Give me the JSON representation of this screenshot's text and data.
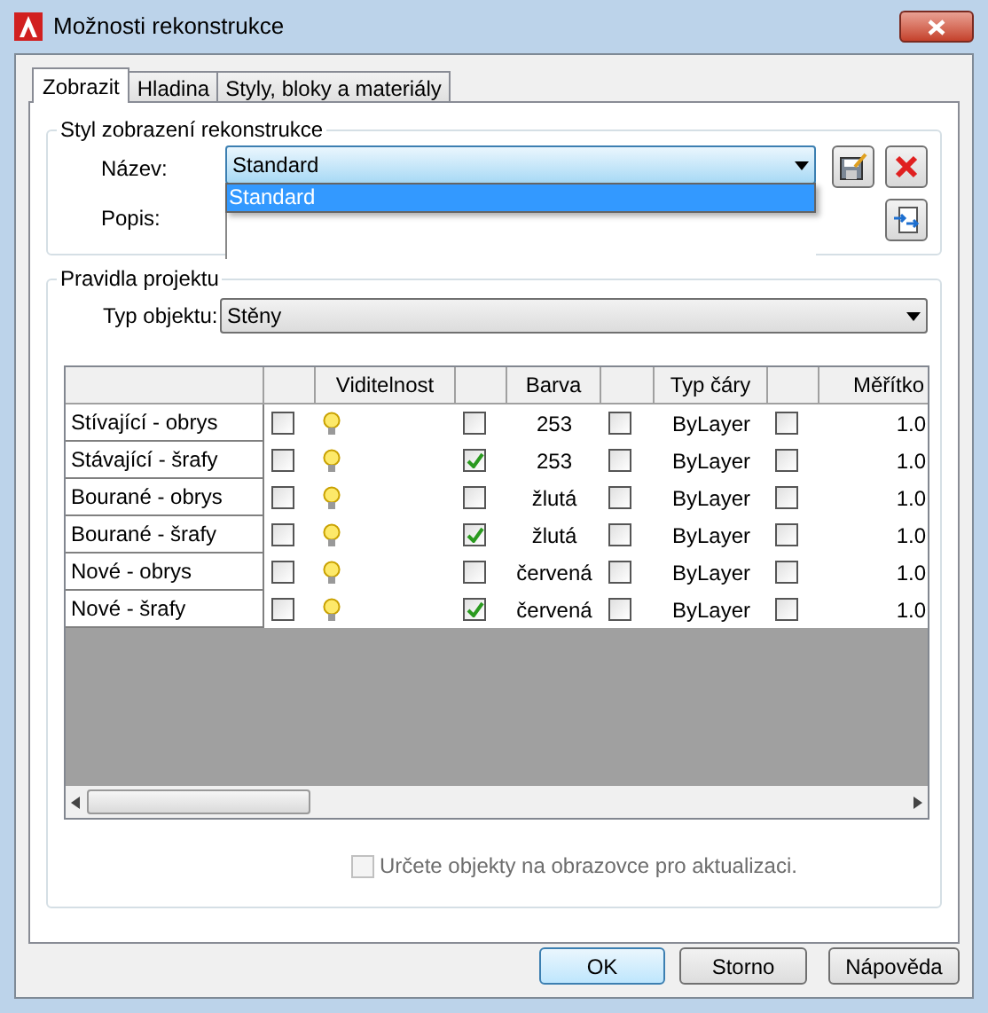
{
  "window": {
    "title": "Možnosti rekonstrukce"
  },
  "tabs": [
    {
      "label": "Zobrazit",
      "selected": true
    },
    {
      "label": "Hladina",
      "selected": false
    },
    {
      "label": "Styly, bloky a materiály",
      "selected": false
    }
  ],
  "style_group": {
    "title": "Styl zobrazení rekonstrukce",
    "name_label": "Název:",
    "name_value": "Standard",
    "dropdown_options": [
      {
        "label": "Standard",
        "selected": true
      }
    ],
    "description_label": "Popis:"
  },
  "rules_group": {
    "title": "Pravidla projektu",
    "object_type_label": "Typ objektu:",
    "object_type_value": "Stěny",
    "table": {
      "columns": [
        "Viditelnost",
        "Barva",
        "Typ čáry",
        "Měřítko"
      ],
      "rows": [
        {
          "name": "Stívající - obrys",
          "check_1": false,
          "visible": true,
          "check_2": false,
          "color_name": "253",
          "check_3": false,
          "linetype": "ByLayer",
          "check_4": false,
          "scale": "1.0"
        },
        {
          "name": "Stávající - šrafy",
          "check_1": false,
          "visible": true,
          "check_2": true,
          "color_name": "253",
          "check_3": false,
          "linetype": "ByLayer",
          "check_4": false,
          "scale": "1.0"
        },
        {
          "name": "Bourané - obrys",
          "check_1": false,
          "visible": true,
          "check_2": false,
          "color_name": "žlutá",
          "check_3": false,
          "linetype": "ByLayer",
          "check_4": false,
          "scale": "1.0"
        },
        {
          "name": "Bourané - šrafy",
          "check_1": false,
          "visible": true,
          "check_2": true,
          "color_name": "žlutá",
          "check_3": false,
          "linetype": "ByLayer",
          "check_4": false,
          "scale": "1.0"
        },
        {
          "name": "Nové - obrys",
          "check_1": false,
          "visible": true,
          "check_2": false,
          "color_name": "červená",
          "check_3": false,
          "linetype": "ByLayer",
          "check_4": false,
          "scale": "1.0"
        },
        {
          "name": "Nové - šrafy",
          "check_1": false,
          "visible": true,
          "check_2": true,
          "color_name": "červená",
          "check_3": false,
          "linetype": "ByLayer",
          "check_4": false,
          "scale": "1.0"
        }
      ]
    },
    "pick_objects": {
      "label": "Určete objekty na obrazovce pro aktualizaci.",
      "checked": false,
      "disabled": true
    }
  },
  "buttons": [
    {
      "label": "OK",
      "default": true
    },
    {
      "label": "Storno",
      "default": false
    },
    {
      "label": "Nápověda",
      "default": false
    }
  ]
}
